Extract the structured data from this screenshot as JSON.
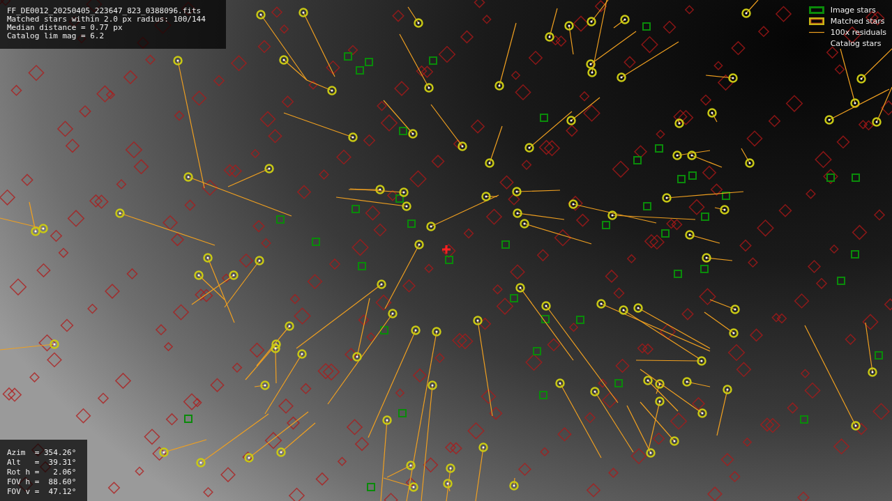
{
  "info_panel": {
    "lines": [
      "FF_DE0012_20250405_223647_823_0388096.fits",
      "Matched stars within 2.0 px radius: 100/144",
      "Median distance = 0.77 px",
      "Catalog lim mag = 6.2"
    ]
  },
  "legend": [
    {
      "kind": "image",
      "label": "Image stars"
    },
    {
      "kind": "matched",
      "label": "Matched stars"
    },
    {
      "kind": "residual",
      "label": "100x residuals"
    },
    {
      "kind": "catalog",
      "label": "Catalog stars"
    }
  ],
  "pointing_panel": {
    "lines": [
      "Azim  = 354.26°",
      "Alt   =  39.31°",
      "Rot h =   2.06°",
      "FOV h =  88.60°",
      "FOV v =  47.12°"
    ]
  }
}
